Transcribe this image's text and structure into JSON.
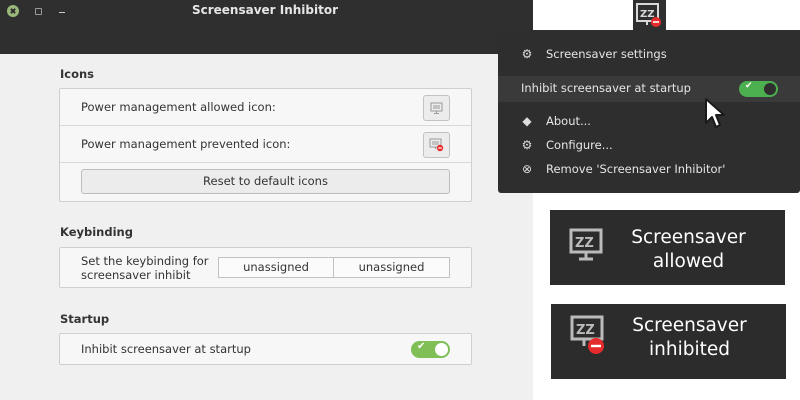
{
  "window": {
    "title": "Screensaver Inhibitor",
    "sections": {
      "icons": {
        "title": "Icons",
        "allowed_label": "Power management allowed icon:",
        "prevented_label": "Power management prevented icon:",
        "reset_label": "Reset to default icons"
      },
      "keybinding": {
        "title": "Keybinding",
        "label_line1": "Set the keybinding for",
        "label_line2": "screensaver inhibit",
        "binding1": "unassigned",
        "binding2": "unassigned"
      },
      "startup": {
        "title": "Startup",
        "inhibit_label": "Inhibit screensaver at startup",
        "inhibit_enabled": true
      }
    }
  },
  "menu": {
    "settings_label": "Screensaver settings",
    "inhibit_label": "Inhibit screensaver at startup",
    "inhibit_enabled": true,
    "about_label": "About...",
    "configure_label": "Configure...",
    "remove_label": "Remove 'Screensaver Inhibitor'"
  },
  "cards": {
    "allowed_line1": "Screensaver",
    "allowed_line2": "allowed",
    "inhibited_line1": "Screensaver",
    "inhibited_line2": "inhibited"
  },
  "icons": {
    "applet": "screensaver-inhibited-icon",
    "settings": "gear-icon",
    "about": "help-icon",
    "configure": "gear-icon",
    "remove": "close-circle-icon",
    "cursor": "mouse-pointer-icon"
  },
  "colors": {
    "toggle_on": "#7fbf55",
    "menu_toggle_on": "#4caf50",
    "inhibit_badge": "#e52b2b",
    "dark_bg": "#2c2c2c"
  }
}
